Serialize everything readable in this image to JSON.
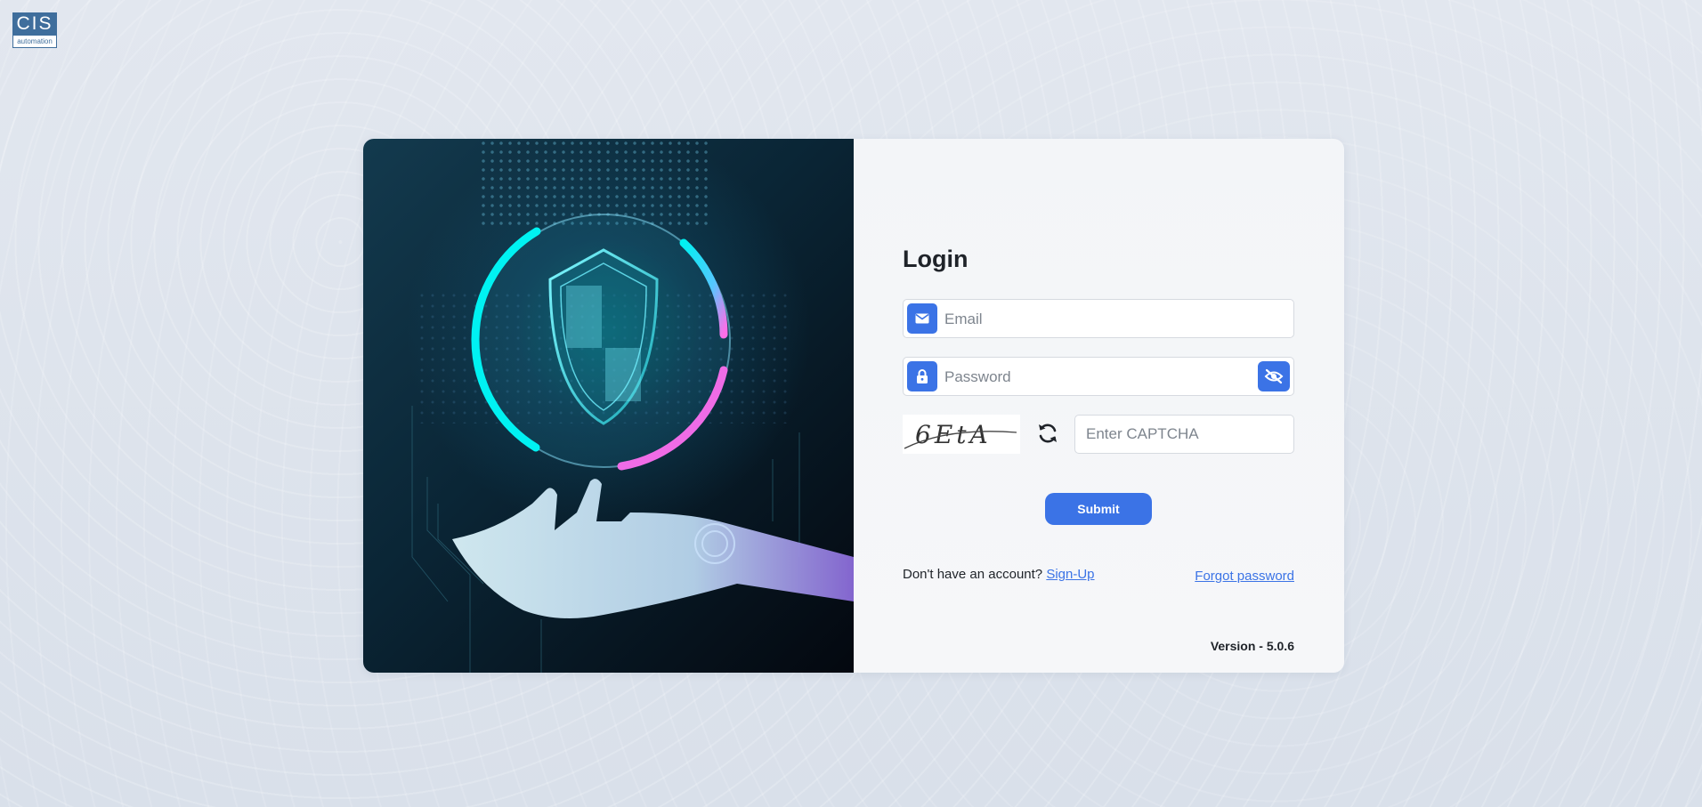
{
  "brand": {
    "logo_text": "CIS",
    "logo_subtext": "automation"
  },
  "login": {
    "title": "Login",
    "email_placeholder": "Email",
    "password_placeholder": "Password",
    "captcha_text": "6EtA",
    "captcha_placeholder": "Enter CAPTCHA",
    "submit_label": "Submit",
    "signup_prompt": "Don't have an account?",
    "signup_link": "Sign-Up",
    "forgot_link": "Forgot password",
    "version": "Version - 5.0.6"
  },
  "icons": {
    "email": "envelope-icon",
    "password": "lock-icon",
    "toggle_password": "eye-slash-icon",
    "refresh_captcha": "refresh-icon"
  },
  "colors": {
    "accent": "#3b73e6",
    "background": "#dfe4ec",
    "panel": "#f4f6f8",
    "text": "#1f2329"
  }
}
